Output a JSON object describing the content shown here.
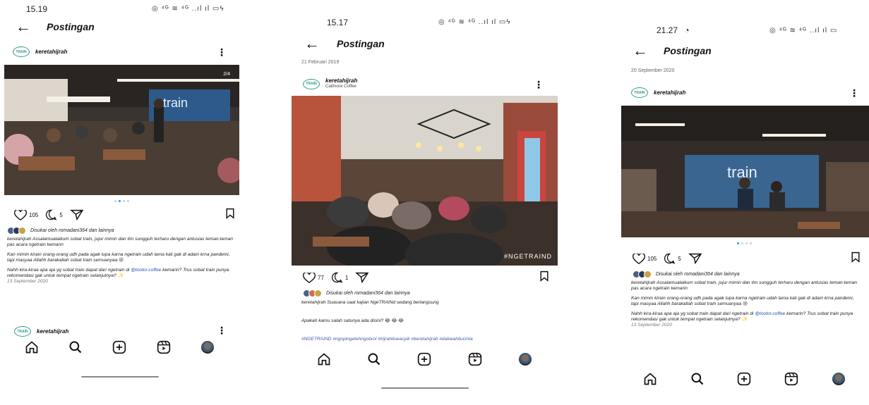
{
  "screens": [
    {
      "time": "15.19",
      "status_icons": "◎ ⁴ᴳ ≋ ⁴ᴳ ..ıl ıl ▭ϟ",
      "page_title": "Postingan",
      "account_user": "keretahijrah",
      "photo_counter": "2/4",
      "likes_count": "105",
      "comments_count": "5",
      "liked_by": "Disukai oleh romadani364 dan lainnya",
      "caption_1": "keretahijrah Assalamualaikum sobat train, jujur mimin dan tim sungguh terharu dengan antusias teman-teman pas acara ngetrain kemarin",
      "caption_2": "Kan mimin kirain orang-orang udh pada agak lupa karna ngetrain udah lama kali gak di adain krna pandemi, tapi masyaa Allahh barakallah sobat train semuanyaa 😢",
      "caption_3_prefix": "Nahh kira-kiraa apa aja yg sobat train dapat dari ngetrain di ",
      "caption_3_link": "@tootor.coffee",
      "caption_3_suffix": " kemarin? Trus sobat train punya rekomendasi gak untuk tempat ngetrain selanjutnya? ✨",
      "post_date": "13 September 2020",
      "next_account_user": "keretahijrah"
    },
    {
      "time": "15.17",
      "status_icons": "◎ ⁴ᴳ ≋ ⁴ᴳ ..ıl ıl ▭ϟ",
      "page_title": "Postingan",
      "prev_date": "21 Februari 2019",
      "account_user": "keretahijrah",
      "account_location": "Catimore Coffee",
      "photo_hashtag": "#NGETRAIND",
      "likes_count": "77",
      "comments_count": "1",
      "liked_by": "Disukai oleh romadani364 dan lainnya",
      "caption_1": "keretahijrah Suasana saat kajian NgeTRAINd sedang berlangsung",
      "caption_2": "Apakah kamu salah satunya ada disini? 😂 😂 😂",
      "hashtags": "#NGETRAIND #ngopingetehngobrol #hijrahitueasyik #keretahijrah #dakwahitucinta"
    },
    {
      "time": "21.27",
      "time_icon": "◔",
      "status_icons": "◎ ⁴ᴳ ≋ ⁴ᴳ ..ıl ıl ▭",
      "page_title": "Postingan",
      "prev_date": "20 September 2020",
      "account_user": "keretahijrah",
      "likes_count": "105",
      "comments_count": "5",
      "liked_by": "Disukai oleh romadani364 dan lainnya",
      "caption_1": "keretahijrah Assalamualaikum sobat train, jujur mimin dan tim sungguh terharu dengan antusias teman-teman pas acara ngetrain kemarin",
      "caption_2": "Kan mimin kirain orang-orang udh pada agak lupa karna ngetrain udah lama kali gak di adain krna pandemi, tapi masyaa Allahh barakallah sobat train semuanyaa 😢",
      "caption_3_prefix": "Nahh kira-kiraa apa aja yg sobat train dapat dari ngetrain di ",
      "caption_3_link": "@tootor.coffee",
      "caption_3_suffix": " kemarin? Trus sobat train punya rekomendasi gak untuk tempat ngetrain selanjutnya? ✨",
      "post_date": "13 September 2020"
    }
  ],
  "logo_text": "TRAIN",
  "colors": {
    "link": "#1d4fb5",
    "dot_active": "#3a8ee6",
    "logo": "#2f9a8c"
  },
  "icons": [
    "back-arrow-icon",
    "more-vert-icon",
    "heart-icon",
    "comment-icon",
    "share-icon",
    "bookmark-icon",
    "home-icon",
    "search-icon",
    "add-post-icon",
    "reels-icon",
    "profile-icon"
  ]
}
